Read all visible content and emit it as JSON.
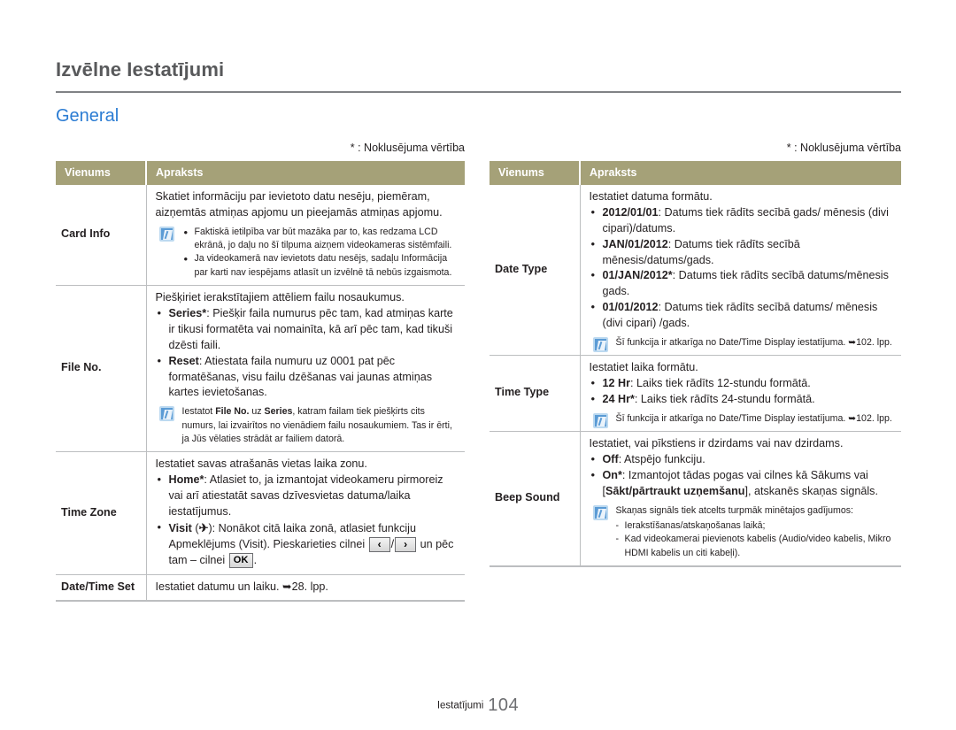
{
  "header": {
    "title": "Izvēlne Iestatījumi",
    "section": "General"
  },
  "default_note": "* : Noklusējuma vērtība",
  "table_headers": {
    "item": "Vienums",
    "description": "Apraksts"
  },
  "left_table": {
    "rows": [
      {
        "item": "Card Info",
        "lead": "Skatiet informāciju par ievietoto datu nesēju, piemēram, aizņemtās atmiņas apjomu un pieejamās atmiņas apjomu.",
        "note_bullets": [
          "Faktiskā ietilpība var būt mazāka par to, kas redzama LCD ekrānā, jo daļu no šī tilpuma aizņem videokameras sistēmfaili.",
          "Ja videokamerā nav ievietots datu nesējs, sadaļu Informācija par karti nav iespējams atlasīt un izvēlnē tā nebūs izgaismota."
        ]
      },
      {
        "item": "File No.",
        "lead": "Piešķiriet ierakstītajiem attēliem failu nosaukumus.",
        "bullets": [
          {
            "term": "Series*",
            "sep": ": ",
            "text": "Piešķir faila numurus pēc tam, kad atmiņas karte ir tikusi formatēta vai nomainīta, kā arī pēc tam, kad tikuši dzēsti faili."
          },
          {
            "term": "Reset",
            "sep": ": ",
            "text": "Atiestata faila numuru uz 0001 pat pēc formatēšanas, visu failu dzēšanas vai jaunas atmiņas kartes ievietošanas."
          }
        ],
        "note_rich": {
          "p1": "Iestatot ",
          "b1": "File No.",
          "p2": " uz ",
          "b2": "Series",
          "p3": ", katram failam tiek piešķirts cits numurs, lai izvairītos no vienādiem failu nosaukumiem. Tas ir ērti, ja Jūs vēlaties strādāt ar failiem datorā."
        }
      },
      {
        "item": "Time Zone",
        "lead": "Iestatiet savas atrašanās vietas laika zonu.",
        "bullets": [
          {
            "term": "Home*",
            "sep": ": ",
            "text": "Atlasiet to, ja izmantojat videokameru pirmoreiz vai arī atiestatāt savas dzīvesvietas datuma/laika iestatījumus."
          }
        ],
        "visit": {
          "term": "Visit",
          "icon": "airplane-icon",
          "icon_glyph": "✈",
          "text_a": "): Nonākot citā laika zonā, atlasiet funkciju Apmeklējums (Visit). Pieskarieties cilnei",
          "key_prev": "‹",
          "key_sep": "/",
          "key_next": "›",
          "text_b": "un pēc tam – cilnei",
          "key_ok": "OK",
          "text_c": "."
        }
      },
      {
        "item": "Date/Time Set",
        "lead_pre": "Iestatiet datumu un laiku. ",
        "lead_ref": "➥28. lpp."
      }
    ]
  },
  "right_table": {
    "rows": [
      {
        "item": "Date Type",
        "lead": "Iestatiet datuma formātu.",
        "bullets": [
          {
            "term": "2012/01/01",
            "sep": ": ",
            "text": "Datums tiek rādīts secībā gads/ mēnesis (divi cipari)/datums."
          },
          {
            "term": "JAN/01/2012",
            "sep": ": ",
            "text": "Datums tiek rādīts secībā mēnesis/datums/gads."
          },
          {
            "term": "01/JAN/2012*",
            "sep": ": ",
            "text": "Datums tiek rādīts secībā datums/mēnesis gads."
          },
          {
            "term": "01/01/2012",
            "sep": ": ",
            "text": "Datums tiek rādīts secībā datums/ mēnesis (divi cipari) /gads."
          }
        ],
        "note": "Šī funkcija ir atkarīga no Date/Time Display iestatījuma. ➥102. lpp."
      },
      {
        "item": "Time Type",
        "lead": "Iestatiet laika formātu.",
        "bullets": [
          {
            "term": "12 Hr",
            "sep": ": ",
            "text": "Laiks tiek rādīts 12-stundu formātā."
          },
          {
            "term": "24 Hr*",
            "sep": ": ",
            "text": "Laiks tiek rādīts 24-stundu formātā."
          }
        ],
        "note": "Šī funkcija ir atkarīga no Date/Time Display iestatījuma. ➥102. lpp."
      },
      {
        "item": "Beep Sound",
        "lead": "Iestatiet, vai pīkstiens ir dzirdams vai nav dzirdams.",
        "bullets": [
          {
            "term": "Off",
            "sep": ": ",
            "text": "Atspējo funkciju."
          }
        ],
        "bullet_on": {
          "term": "On*",
          "sep": ": ",
          "t1": "Izmantojot tādas pogas vai cilnes kā Sākums vai [",
          "b1": "Sākt/pārtraukt uzņemšanu",
          "t2": "], atskanēs skaņas signāls."
        },
        "note_lead": "Skaņas signāls tiek atcelts turpmāk minētajos gadījumos:",
        "note_dashes": [
          "Ierakstīšanas/atskaņošanas laikā;",
          "Kad videokamerai pievienots kabelis (Audio/video kabelis, Mikro HDMI kabelis un citi kabeļi)."
        ]
      }
    ]
  },
  "footer": {
    "label": "Iestatījumi",
    "page": "104"
  }
}
